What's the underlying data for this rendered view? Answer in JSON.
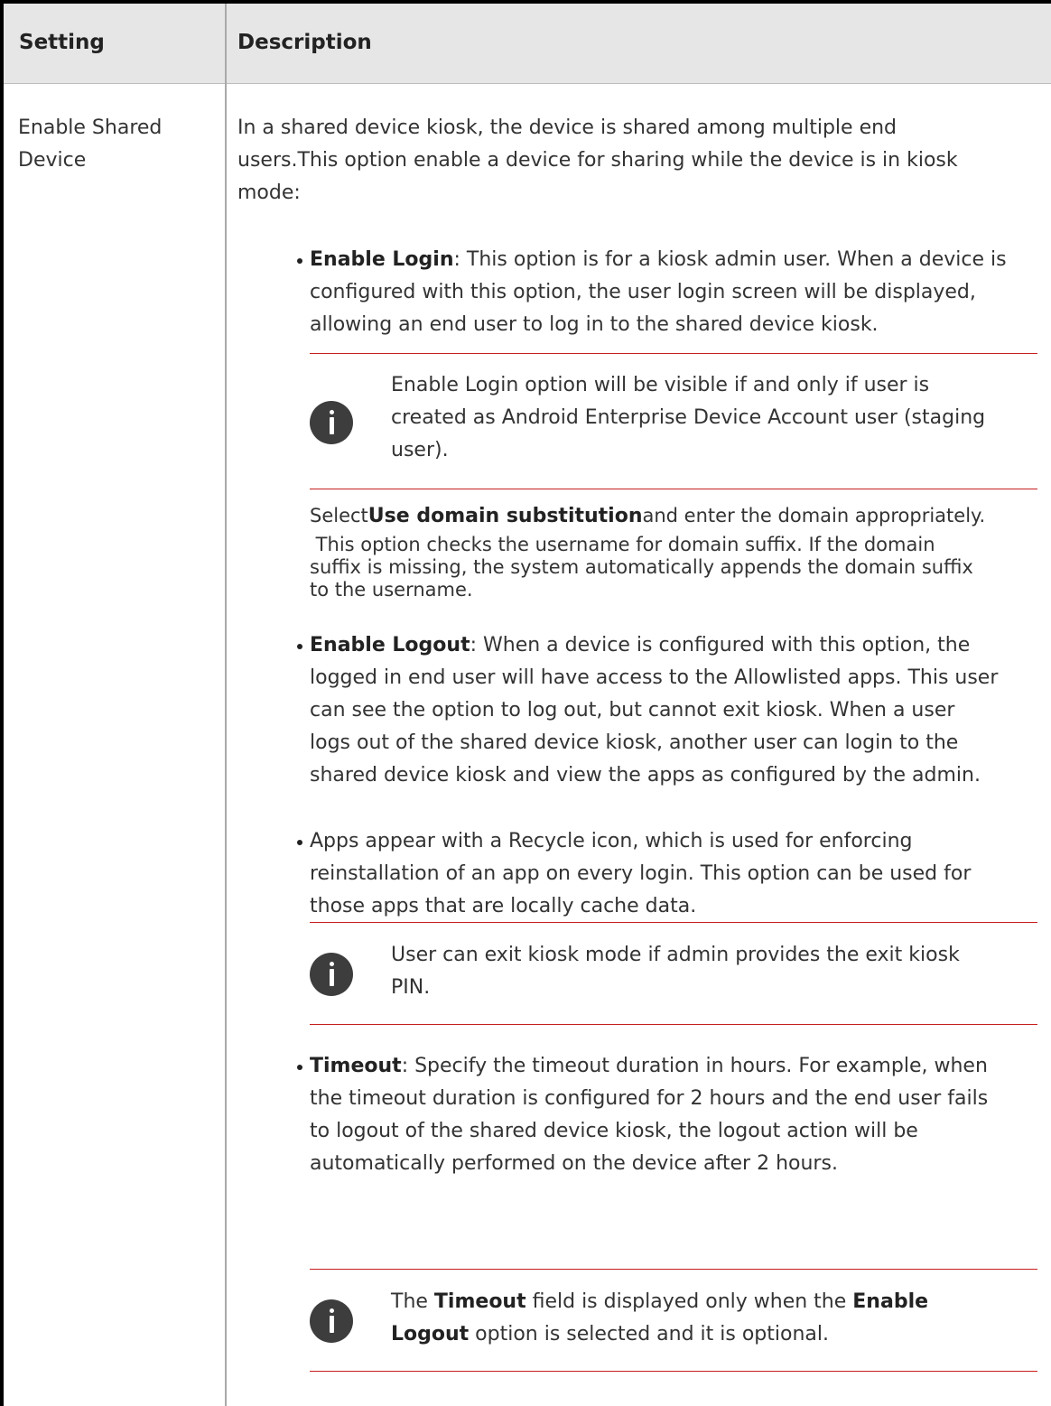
{
  "table": {
    "header_setting": "Setting",
    "header_description": "Description",
    "row": {
      "setting_line1": "Enable Shared",
      "setting_line2": "Device",
      "intro_line1": "In a shared device kiosk, the device is shared among multiple end",
      "intro_line2": "users.This option enable a device for sharing while the device is in kiosk",
      "intro_line3": "mode:",
      "enable_login": {
        "label": "Enable Login",
        "line1_rest": ": This option is for a kiosk admin user. When a device is",
        "line2": "configured with this option, the user login screen will be displayed,",
        "line3": "allowing an end user to log in to the shared device kiosk."
      },
      "note1": {
        "line1": "Enable Login option will be visible if and only if user is",
        "line2": "created as Android Enterprise Device Account user (staging",
        "line3": "user)."
      },
      "domain": {
        "select_word": "Select",
        "label": "Use domain substitution",
        "line1_rest": "and enter the domain appropriately.",
        "line2": " This option checks the username for domain suffix. If the domain",
        "line3": "suffix is missing, the system automatically appends the domain suffix",
        "line4": "to the username."
      },
      "enable_logout": {
        "label": "Enable Logout",
        "line1_rest": ": When a device is configured with this option, the",
        "line2": "logged in end user will have access to the Allowlisted apps. This user",
        "line3": "can see the option to log out, but cannot exit kiosk. When a user",
        "line4": "logs out of the shared device kiosk, another user can login to the",
        "line5": "shared device kiosk and view the apps as configured by the admin."
      },
      "recycle": {
        "line1": "Apps appear with a Recycle icon, which is used for enforcing",
        "line2": "reinstallation of an app on every login. This option can be used for",
        "line3": "those apps that are locally cache data."
      },
      "note2": {
        "line1": "User can exit kiosk mode if admin provides the exit kiosk",
        "line2": "PIN."
      },
      "timeout": {
        "label": "Timeout",
        "line1_rest": ": Specify the timeout duration in hours. For example, when",
        "line2": "the timeout duration is configured for 2 hours and the end user fails",
        "line3": "to logout of the shared device kiosk, the logout action will be",
        "line4": "automatically performed on the device after 2 hours."
      },
      "note3": {
        "prefix": "The ",
        "timeout_label": "Timeout",
        "middle": " field is displayed only when the ",
        "enable_label": "Enable",
        "logout_label": "Logout",
        "suffix": " option is selected and it is optional."
      }
    }
  }
}
